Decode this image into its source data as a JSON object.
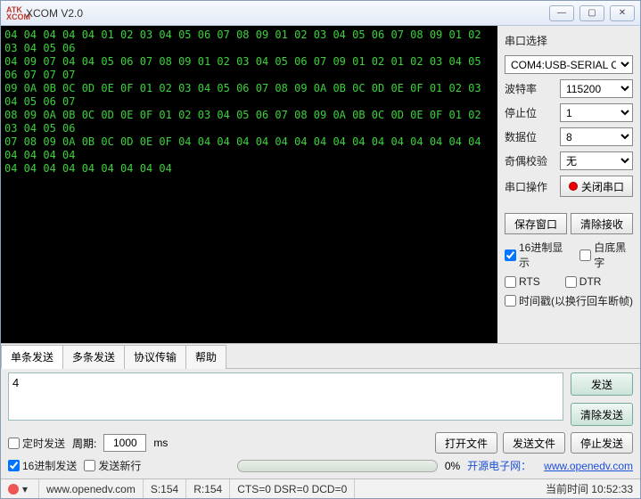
{
  "title": "XCOM V2.0",
  "console_text": "04 04 04 04 04 01 02 03 04 05 06 07 08 09 01 02 03 04 05 06 07 08 09 01 02 03 04 05 06\n04 09 07 04 04 05 06 07 08 09 01 02 03 04 05 06 07 09 01 02 01 02 03 04 05 06 07 07 07\n09 0A 0B 0C 0D 0E 0F 01 02 03 04 05 06 07 08 09 0A 0B 0C 0D 0E 0F 01 02 03 04 05 06 07\n08 09 0A 0B 0C 0D 0E 0F 01 02 03 04 05 06 07 08 09 0A 0B 0C 0D 0E 0F 01 02 03 04 05 06\n07 08 09 0A 0B 0C 0D 0E 0F 04 04 04 04 04 04 04 04 04 04 04 04 04 04 04 04 04 04 04 04\n04 04 04 04 04 04 04 04 04",
  "side": {
    "port_label": "串口选择",
    "port_value": "COM4:USB-SERIAL CH340",
    "baud_label": "波特率",
    "baud_value": "115200",
    "stop_label": "停止位",
    "stop_value": "1",
    "data_label": "数据位",
    "data_value": "8",
    "parity_label": "奇偶校验",
    "parity_value": "无",
    "op_label": "串口操作",
    "op_btn": "关闭串口",
    "save_btn": "保存窗口",
    "clear_btn": "清除接收",
    "hex_disp": "16进制显示",
    "bw": "白底黑字",
    "rts": "RTS",
    "dtr": "DTR",
    "timestamp": "时间戳(以换行回车断帧)"
  },
  "tabs": [
    "单条发送",
    "多条发送",
    "协议传输",
    "帮助"
  ],
  "send": {
    "value": "4",
    "send_btn": "发送",
    "clear_btn": "清除发送"
  },
  "opts": {
    "timed": "定时发送",
    "period_label": "周期:",
    "period_value": "1000",
    "period_unit": "ms",
    "open_file": "打开文件",
    "send_file": "发送文件",
    "stop_send": "停止发送",
    "hex_send": "16进制发送",
    "send_newline": "发送新行",
    "progress_pct": "0%",
    "link_label": "开源电子网：",
    "link_url": "www.openedv.com"
  },
  "status": {
    "url": "www.openedv.com",
    "s": "S:154",
    "r": "R:154",
    "cts": "CTS=0 DSR=0 DCD=0",
    "time": "当前时间 10:52:33"
  }
}
